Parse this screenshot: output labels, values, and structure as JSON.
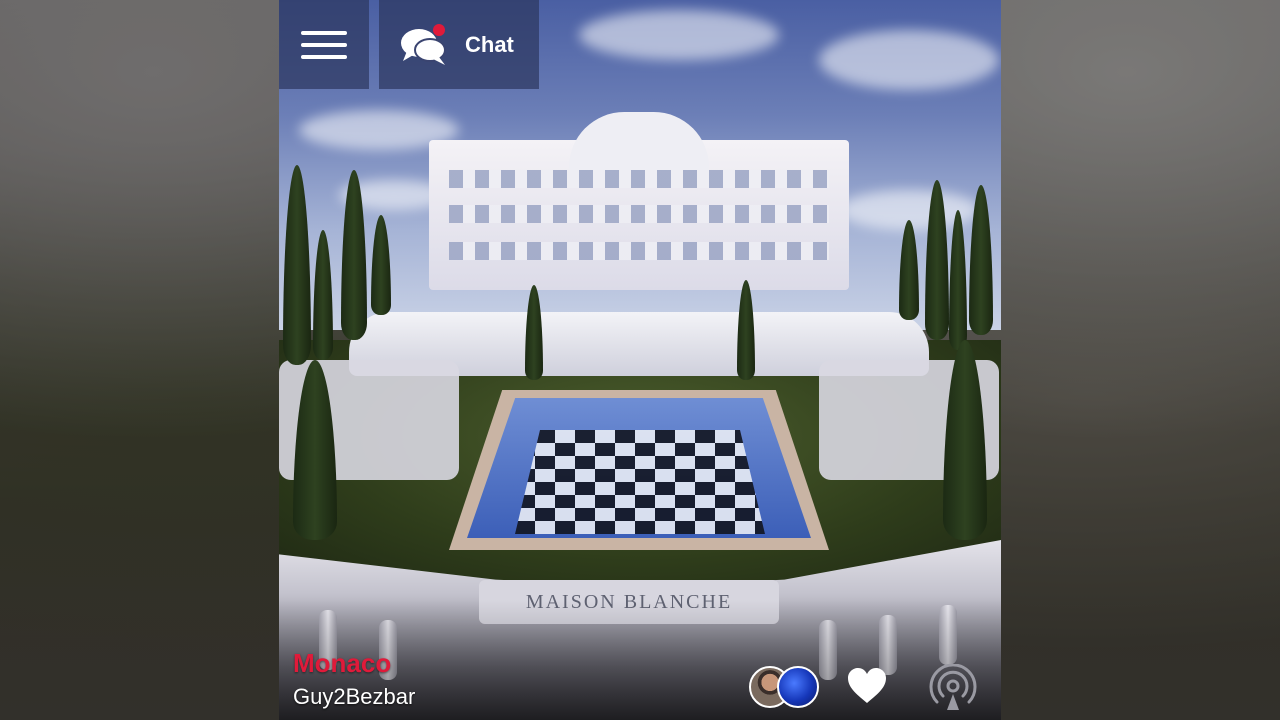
{
  "header": {
    "menu_icon": "hamburger-menu-icon",
    "chat_icon": "chat-bubbles-icon",
    "chat_label": "Chat",
    "chat_notification_color": "#e01a3a"
  },
  "scene": {
    "plaque_text": "MAISON BLANCHE"
  },
  "footer": {
    "location_name": "Monaco",
    "location_color": "#e01a3a",
    "username": "Guy2Bezbar",
    "avatars": [
      "user-avatar",
      "globe-avatar"
    ],
    "like_icon": "heart-icon",
    "broadcast_icon": "broadcast-icon"
  }
}
